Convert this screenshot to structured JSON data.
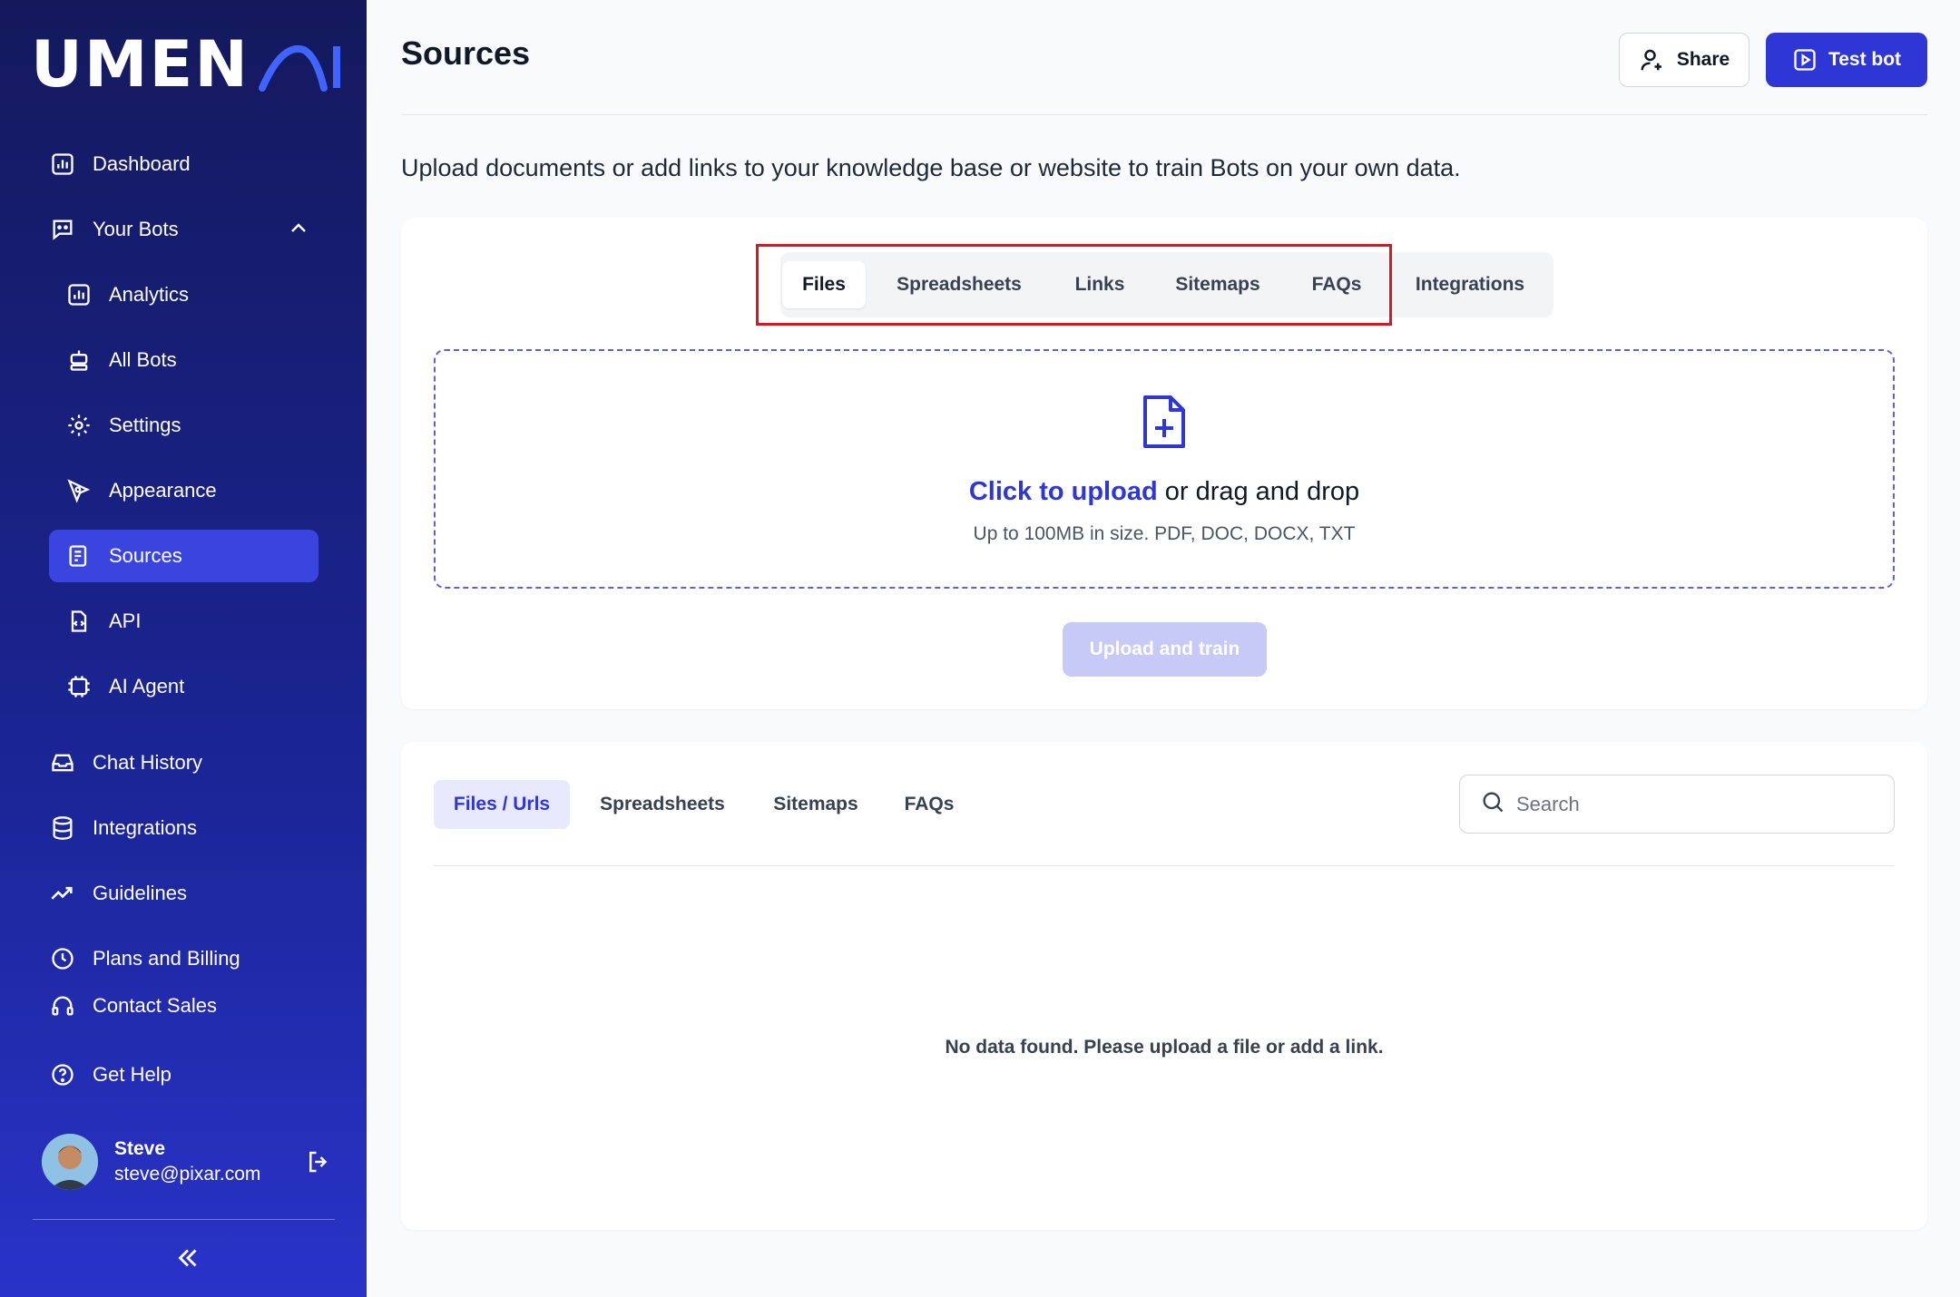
{
  "brand": {
    "logo_text": "UMEN"
  },
  "sidebar": {
    "items": [
      {
        "label": "Dashboard",
        "icon": "chart-bar-icon"
      },
      {
        "label": "Your Bots",
        "icon": "bot-chat-icon"
      },
      {
        "label": "Analytics",
        "icon": "chart-bar-icon"
      },
      {
        "label": "All Bots",
        "icon": "robot-icon"
      },
      {
        "label": "Settings",
        "icon": "gear-icon"
      },
      {
        "label": "Appearance",
        "icon": "pen-tool-icon"
      },
      {
        "label": "Sources",
        "icon": "document-icon"
      },
      {
        "label": "API",
        "icon": "code-file-icon"
      },
      {
        "label": "AI Agent",
        "icon": "ai-chip-icon"
      },
      {
        "label": "Chat History",
        "icon": "inbox-icon"
      },
      {
        "label": "Integrations",
        "icon": "database-icon"
      },
      {
        "label": "Guidelines",
        "icon": "trend-up-icon"
      },
      {
        "label": "Plans and Billing",
        "icon": "clock-icon"
      },
      {
        "label": "Contact Sales",
        "icon": "headphones-icon"
      },
      {
        "label": "Get Help",
        "icon": "help-circle-icon"
      }
    ],
    "user": {
      "name": "Steve",
      "email": "steve@pixar.com"
    }
  },
  "header": {
    "title": "Sources",
    "share_label": "Share",
    "test_label": "Test bot"
  },
  "intro": "Upload documents or add links to your knowledge base or website to train Bots on your own data.",
  "upload": {
    "tabs": [
      "Files",
      "Spreadsheets",
      "Links",
      "Sitemaps",
      "FAQs",
      "Integrations"
    ],
    "click_label": "Click to upload",
    "drag_label": " or drag and drop",
    "hint": "Up to 100MB in size. PDF, DOC, DOCX, TXT",
    "button_label": "Upload and train"
  },
  "data_panel": {
    "tabs": [
      "Files / Urls",
      "Spreadsheets",
      "Sitemaps",
      "FAQs"
    ],
    "search_placeholder": "Search",
    "empty_message": "No data found. Please upload a file or add a link."
  },
  "colors": {
    "accent": "#2e36d6",
    "sidebar_active": "#3a45e0",
    "highlight": "#e0141e"
  }
}
